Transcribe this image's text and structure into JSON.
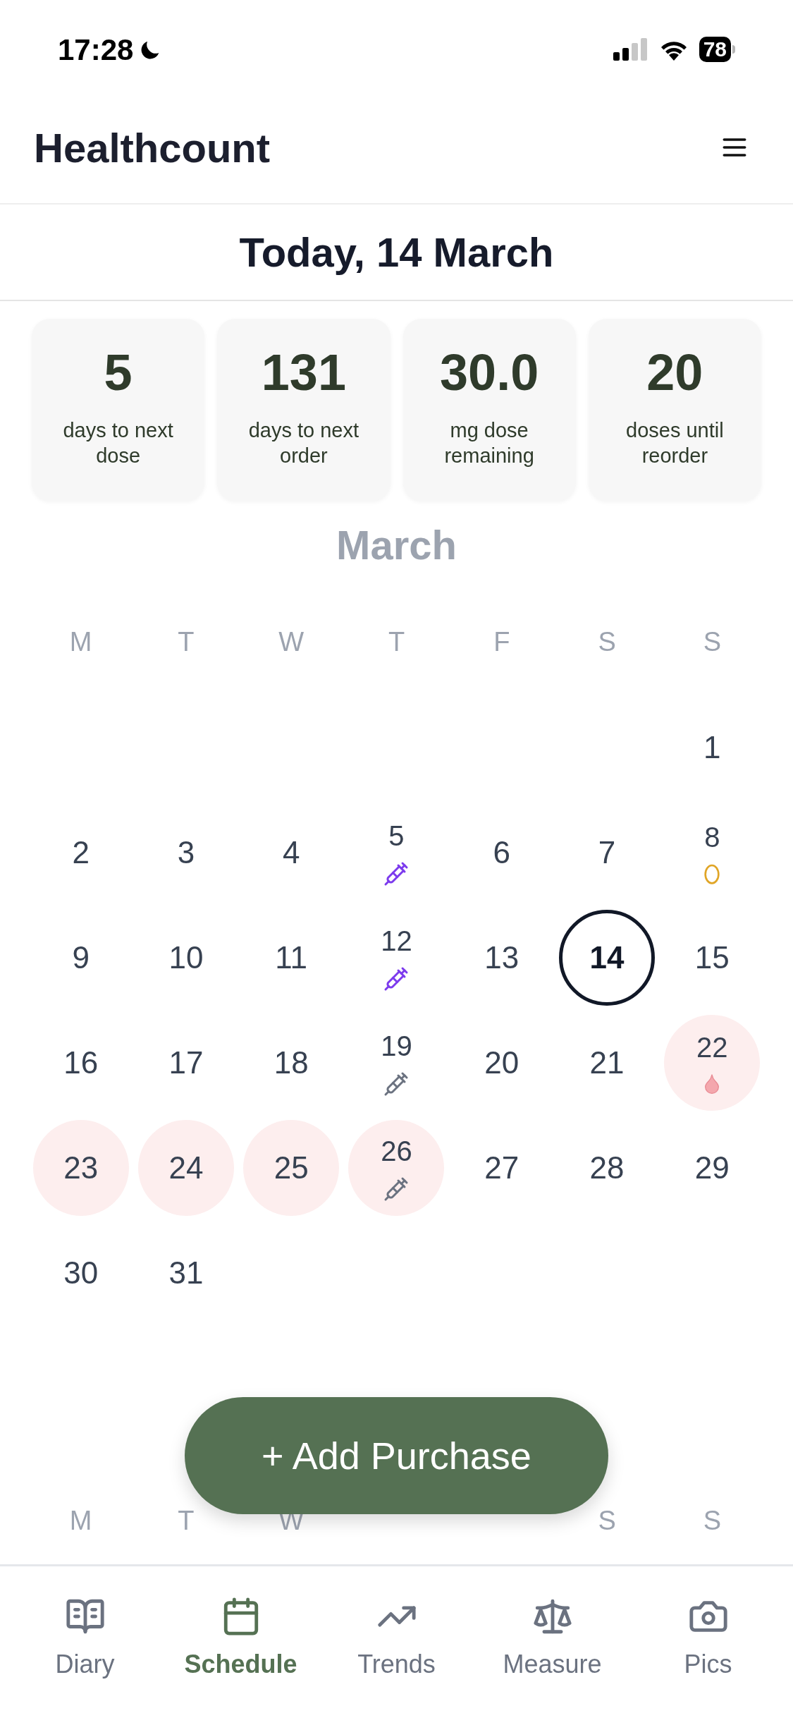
{
  "status_bar": {
    "time": "17:28",
    "battery": "78"
  },
  "header": {
    "title": "Healthcount"
  },
  "date_bar": {
    "title": "Today, 14 March"
  },
  "stats": [
    {
      "value": "5",
      "label": "days to next dose"
    },
    {
      "value": "131",
      "label": "days to next order"
    },
    {
      "value": "30.0",
      "label": "mg dose remaining"
    },
    {
      "value": "20",
      "label": "doses until reorder"
    }
  ],
  "calendar": {
    "month": "March",
    "weekdays": [
      "M",
      "T",
      "W",
      "T",
      "F",
      "S",
      "S"
    ],
    "weeks": [
      [
        {
          "day": "1",
          "today": false,
          "highlighted": false
        }
      ],
      [
        {
          "day": "2",
          "today": false,
          "highlighted": false
        },
        {
          "day": "3",
          "today": false,
          "highlighted": false
        },
        {
          "day": "4",
          "today": false,
          "highlighted": false
        },
        {
          "day": "5",
          "today": false,
          "highlighted": false,
          "marker": {
            "kind": "syringe",
            "color": "#7c3aed"
          }
        },
        {
          "day": "6",
          "today": false,
          "highlighted": false
        },
        {
          "day": "7",
          "today": false,
          "highlighted": false
        },
        {
          "day": "8",
          "today": false,
          "highlighted": false,
          "marker": {
            "kind": "oval",
            "color": "#e0a526"
          }
        }
      ],
      [
        {
          "day": "9",
          "today": false,
          "highlighted": false
        },
        {
          "day": "10",
          "today": false,
          "highlighted": false
        },
        {
          "day": "11",
          "today": false,
          "highlighted": false
        },
        {
          "day": "12",
          "today": false,
          "highlighted": false,
          "marker": {
            "kind": "syringe",
            "color": "#7c3aed"
          }
        },
        {
          "day": "13",
          "today": false,
          "highlighted": false
        },
        {
          "day": "14",
          "today": true,
          "highlighted": false
        },
        {
          "day": "15",
          "today": false,
          "highlighted": false
        }
      ],
      [
        {
          "day": "16",
          "today": false,
          "highlighted": false
        },
        {
          "day": "17",
          "today": false,
          "highlighted": false
        },
        {
          "day": "18",
          "today": false,
          "highlighted": false
        },
        {
          "day": "19",
          "today": false,
          "highlighted": false,
          "marker": {
            "kind": "syringe",
            "color": "#6b7280"
          }
        },
        {
          "day": "20",
          "today": false,
          "highlighted": false
        },
        {
          "day": "21",
          "today": false,
          "highlighted": false
        },
        {
          "day": "22",
          "today": false,
          "highlighted": true,
          "marker": {
            "kind": "drop",
            "color": "#f4a7ad"
          }
        }
      ],
      [
        {
          "day": "23",
          "today": false,
          "highlighted": true
        },
        {
          "day": "24",
          "today": false,
          "highlighted": true
        },
        {
          "day": "25",
          "today": false,
          "highlighted": true
        },
        {
          "day": "26",
          "today": false,
          "highlighted": true,
          "marker": {
            "kind": "syringe",
            "color": "#6b7280"
          }
        },
        {
          "day": "27",
          "today": false,
          "highlighted": false
        },
        {
          "day": "28",
          "today": false,
          "highlighted": false
        },
        {
          "day": "29",
          "today": false,
          "highlighted": false
        }
      ],
      [
        {
          "day": "30",
          "today": false,
          "highlighted": false
        },
        {
          "day": "31",
          "today": false,
          "highlighted": false
        }
      ]
    ]
  },
  "next_month": {
    "weekdays": [
      "M",
      "T",
      "W",
      "S",
      "S"
    ]
  },
  "add_button": {
    "label": "+ Add Purchase"
  },
  "tabs": [
    {
      "kind": "diary",
      "label": "Diary",
      "selected": false
    },
    {
      "kind": "schedule",
      "label": "Schedule",
      "selected": true
    },
    {
      "kind": "trends",
      "label": "Trends",
      "selected": false
    },
    {
      "kind": "measure",
      "label": "Measure",
      "selected": false
    },
    {
      "kind": "pics",
      "label": "Pics",
      "selected": false
    }
  ]
}
